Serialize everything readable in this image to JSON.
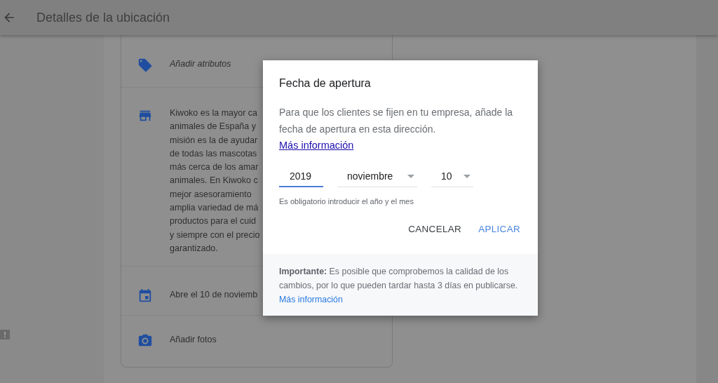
{
  "header": {
    "title": "Detalles de la ubicación"
  },
  "card": {
    "rows": [
      {
        "kind": "tag",
        "lines": [
          "Añadir atributos"
        ],
        "italic": true
      },
      {
        "kind": "store",
        "lines": [
          "Kiwoko es la mayor ca",
          "animales de España y",
          "misión es la de ayudar",
          "de todas las mascotas",
          "más cerca de los amar",
          "animales. En Kiwoko c",
          "mejor asesoramiento",
          "amplia variedad de má",
          "productos para el cuid",
          "y siempre con el precio",
          "garantizado."
        ],
        "italic": false
      },
      {
        "kind": "calendar",
        "lines": [
          "Abre el 10 de noviemb"
        ],
        "italic": false
      },
      {
        "kind": "camera",
        "lines": [
          "Añadir fotos"
        ],
        "italic": false
      }
    ]
  },
  "dialog": {
    "title": "Fecha de apertura",
    "text": "Para que los clientes se fijen en tu empresa, añade la fecha de apertura en esta dirección.",
    "link": "Más información",
    "fields": [
      {
        "kind": "input",
        "value": "2019",
        "focused": true
      },
      {
        "kind": "select",
        "value": "noviembre",
        "focused": false
      },
      {
        "kind": "select",
        "value": "10",
        "focused": false
      }
    ],
    "helper": "Es obligatorio introducir el año y el mes",
    "buttons": [
      {
        "label": "CANCELAR",
        "primary": false
      },
      {
        "label": "APLICAR",
        "primary": true
      }
    ],
    "footer": {
      "text": "**Importante:** Es posible que comprobemos la calidad de los cambios, por lo que pueden tardar hasta 3 días en publicarse.",
      "link": "Más información"
    }
  }
}
